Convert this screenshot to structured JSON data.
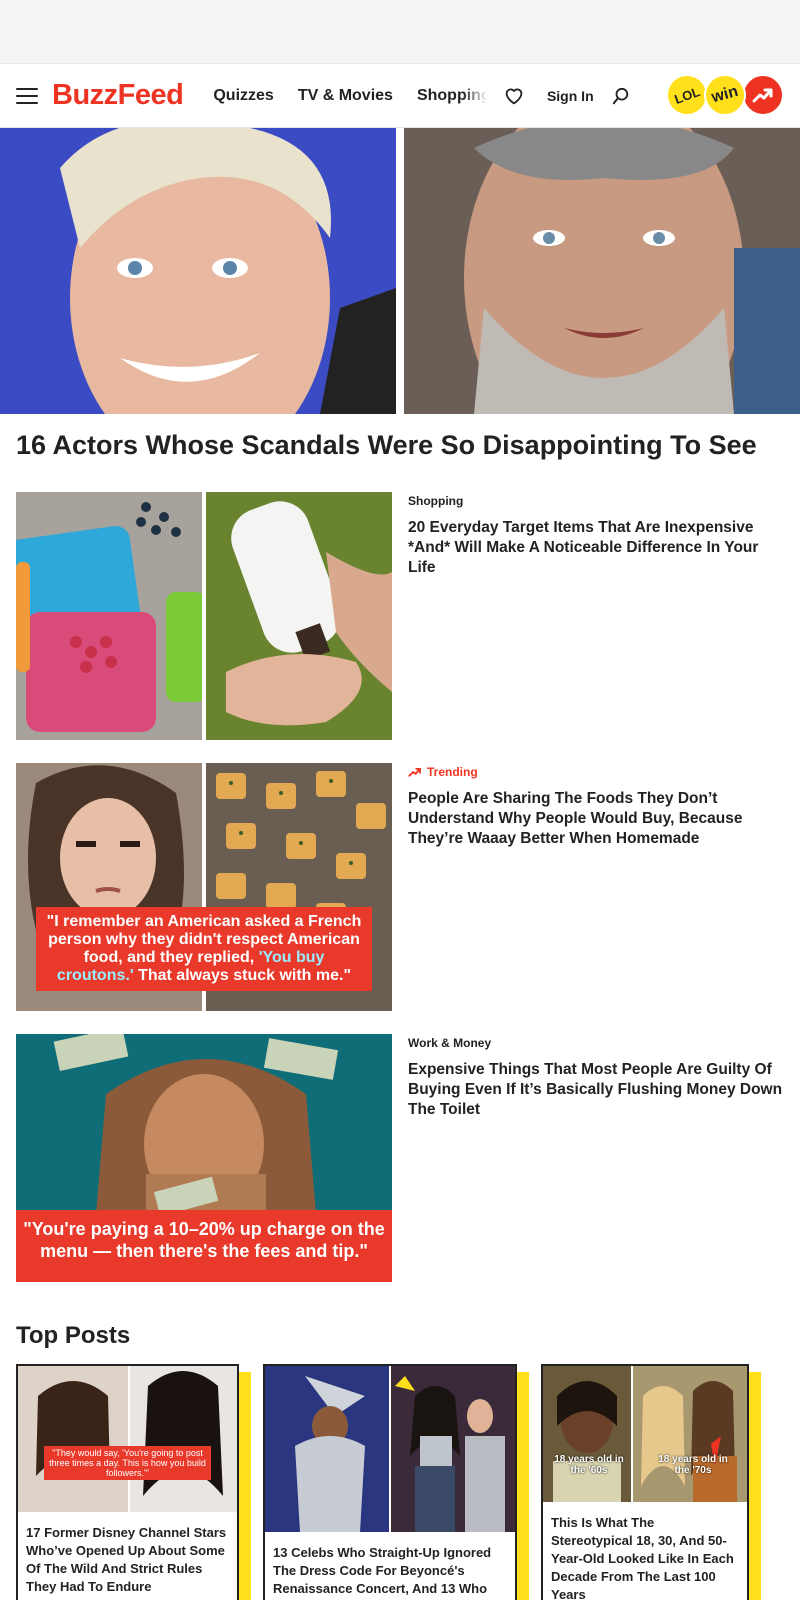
{
  "nav": {
    "logo": "BuzzFeed",
    "links": [
      "Quizzes",
      "TV & Movies",
      "Shopping"
    ],
    "sign_in": "Sign In",
    "badges": [
      "LOL",
      "win"
    ]
  },
  "hero": {
    "title": "16 Actors Whose Scandals Were So Disappointing To See"
  },
  "articles": [
    {
      "tag": "Shopping",
      "title": "20 Everyday Target Items That Are Inexpensive *And* Will Make A Noticeable Difference In Your Life"
    },
    {
      "tag": "Trending",
      "title": "People Are Sharing The Foods They Don’t Understand Why People Would Buy, Because They’re Waaay Better When Homemade",
      "image_caption_a": "\"I remember an American asked a French person why they didn't respect American food, and they replied, ",
      "image_caption_hl": "'You buy croutons.'",
      "image_caption_b": " That always stuck with me.\""
    },
    {
      "tag": "Work & Money",
      "title": "Expensive Things That Most People Are Guilty Of Buying Even If It’s Basically Flushing Money Down The Toilet",
      "image_caption": "\"You're paying a 10–20% up charge on the menu — then there's the fees and tip.\""
    }
  ],
  "top_posts": {
    "heading": "Top Posts",
    "cards": [
      {
        "title": "17 Former Disney Channel Stars Who’ve Opened Up About Some Of The Wild And Strict Rules They Had To Endure",
        "image_caption": "\"They would say, 'You're going to post three times a day. This is how you build followers.'\""
      },
      {
        "title": "13 Celebs Who Straight-Up Ignored The Dress Code For Beyoncé's Renaissance Concert, And 13 Who"
      },
      {
        "title": "This Is What The Stereotypical 18, 30, And 50-Year-Old Looked Like In Each Decade From The Last 100 Years",
        "label_a": "18 years old in the '60s",
        "label_b": "18 years old in the '70s"
      }
    ]
  },
  "colors": {
    "brand_red": "#ee3322",
    "accent_yellow": "#ffe01b",
    "hero_left_bg": "#3b4cc6"
  }
}
